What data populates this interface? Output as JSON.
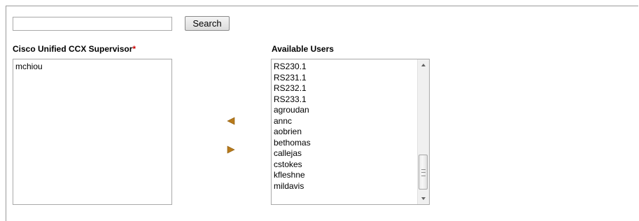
{
  "search": {
    "value": "",
    "placeholder": "",
    "button_label": "Search"
  },
  "supervisor": {
    "label": "Cisco Unified CCX Supervisor",
    "required_mark": "*",
    "items": [
      "mchiou"
    ]
  },
  "available": {
    "label": "Available Users",
    "items": [
      "RS230.1",
      "RS231.1",
      "RS232.1",
      "RS233.1",
      "agroudan",
      "annc",
      "aobrien",
      "bethomas",
      "callejas",
      "cstokes",
      "kfleshne",
      "mildavis"
    ]
  },
  "icons": {
    "move_left": "left-arrow-icon",
    "move_right": "right-arrow-icon",
    "scroll_up": "scroll-up-icon",
    "scroll_down": "scroll-down-icon"
  },
  "colors": {
    "arrow": "#b87a1a",
    "required": "#cc0000"
  }
}
